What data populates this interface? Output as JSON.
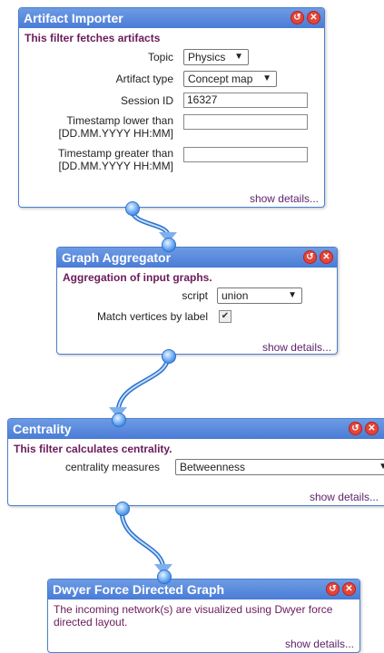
{
  "nodes": [
    {
      "title": "Artifact Importer",
      "description": "This filter fetches artifacts",
      "fields": {
        "topic_label": "Topic",
        "topic_value": "Physics",
        "artifact_type_label": "Artifact type",
        "artifact_type_value": "Concept map",
        "session_id_label": "Session ID",
        "session_id_value": "16327",
        "ts_lower_label": "Timestamp lower than [DD.MM.YYYY HH:MM]",
        "ts_lower_value": "",
        "ts_greater_label": "Timestamp greater than [DD.MM.YYYY HH:MM]",
        "ts_greater_value": ""
      },
      "details_link": "show details..."
    },
    {
      "title": "Graph Aggregator",
      "description": "Aggregation of input graphs.",
      "fields": {
        "script_label": "script",
        "script_value": "union",
        "match_label": "Match vertices by label",
        "match_checked": true
      },
      "details_link": "show details..."
    },
    {
      "title": "Centrality",
      "description": "This filter calculates centrality.",
      "fields": {
        "measures_label": "centrality measures",
        "measures_value": "Betweenness"
      },
      "details_link": "show details..."
    },
    {
      "title": "Dwyer Force Directed Graph",
      "description": "The incoming network(s) are visualized using Dwyer force directed layout.",
      "details_link": "show details..."
    }
  ],
  "icons": {
    "reset": "reset-icon",
    "close": "close-icon",
    "dropdown": "dropdown-arrow-icon",
    "checkmark": "check-icon"
  },
  "colors": {
    "header": "#4a7cd6",
    "description": "#6a1b5a",
    "wire": "#2f6fc9",
    "close_button": "#e2453a"
  }
}
